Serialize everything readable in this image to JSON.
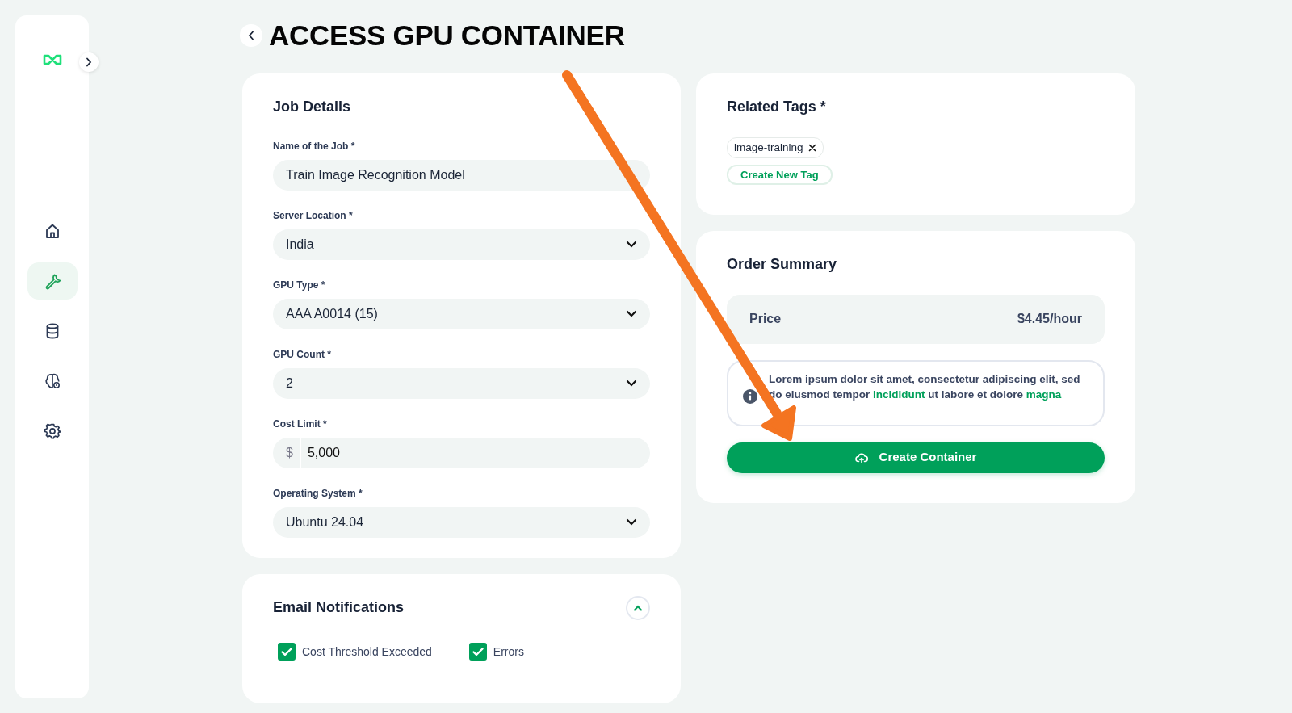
{
  "sidebar": {
    "items": [
      {
        "selected": false
      },
      {
        "selected": true
      },
      {
        "selected": false
      },
      {
        "selected": false
      },
      {
        "selected": false
      }
    ]
  },
  "page": {
    "title": "ACCESS GPU CONTAINER"
  },
  "job_details": {
    "heading": "Job Details",
    "fields": [
      {
        "kind": "text",
        "label": "Name of the Job *",
        "value": "Train Image Recognition Model"
      },
      {
        "kind": "select",
        "label": "Server Location *",
        "value": "India"
      },
      {
        "kind": "select",
        "label": "GPU Type *",
        "value": "AAA A0014 (15)"
      },
      {
        "kind": "select",
        "label": "GPU Count *",
        "value": "2"
      },
      {
        "kind": "currency",
        "label": "Cost Limit *",
        "prefix": "$",
        "value": "5,000"
      },
      {
        "kind": "select",
        "label": "Operating System *",
        "value": "Ubuntu 24.04"
      }
    ]
  },
  "email_notifications": {
    "heading": "Email Notifications",
    "expanded": true,
    "options": [
      {
        "label": "Cost Threshold Exceeded",
        "checked": true
      },
      {
        "label": "Errors",
        "checked": true
      }
    ]
  },
  "related_tags": {
    "heading": "Related Tags *",
    "tags": [
      "image-training"
    ],
    "create_button": "Create New Tag"
  },
  "order_summary": {
    "heading": "Order Summary",
    "price_label": "Price",
    "price_value": "$4.45/hour",
    "note": [
      {
        "text": "Lorem ipsum dolor sit amet, consectetur adipiscing elit, sed do eiusmod tempor ",
        "highlight": false
      },
      {
        "text": "incididunt",
        "highlight": true
      },
      {
        "text": " ut labore et dolore ",
        "highlight": false
      },
      {
        "text": "magna",
        "highlight": true
      }
    ],
    "button": "Create Container"
  }
}
